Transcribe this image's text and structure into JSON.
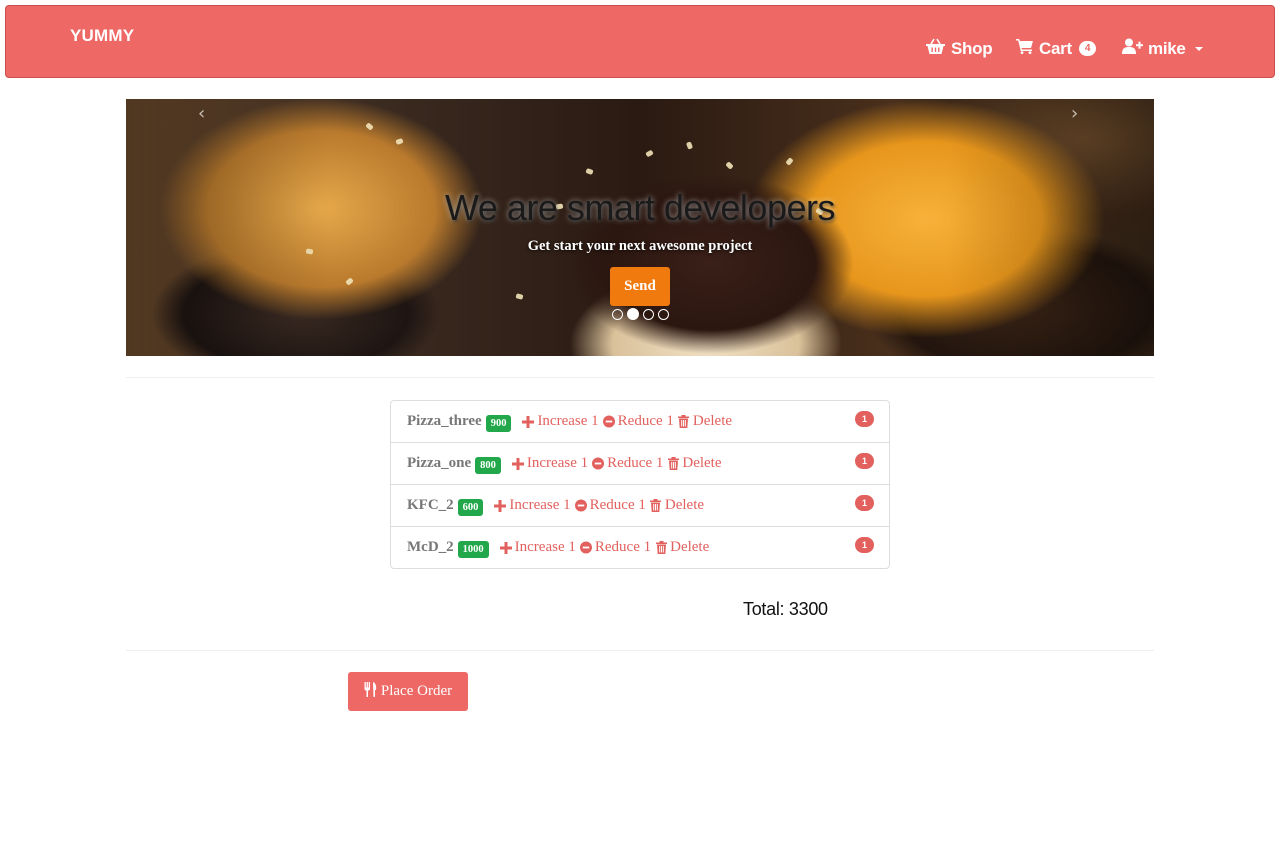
{
  "colors": {
    "navbar": "#ee6865",
    "accent": "#e2615e",
    "send_button": "#f07a0e",
    "price_badge": "#22a84a"
  },
  "navbar": {
    "brand": "YUMMY",
    "shop": {
      "label": "Shop",
      "icon": "shopping-basket-icon"
    },
    "cart": {
      "label": "Cart",
      "count": "4",
      "icon": "shopping-cart-icon"
    },
    "user": {
      "label": "mike",
      "icon": "user-plus-icon"
    }
  },
  "carousel": {
    "title": "We are smart developers",
    "subtitle": "Get start your next awesome project",
    "button": "Send",
    "prev_icon": "chevron-left-icon",
    "next_icon": "chevron-right-icon",
    "prev_glyph": "‹",
    "next_glyph": "›",
    "slide_count": 4,
    "active_index": 1
  },
  "cart": {
    "items": [
      {
        "name": "Pizza_three",
        "price": "900",
        "increase": "Increase 1",
        "reduce": "Reduce 1",
        "delete": "Delete",
        "qty": "1"
      },
      {
        "name": "Pizza_one",
        "price": "800",
        "increase": "Increase 1",
        "reduce": "Reduce 1",
        "delete": "Delete",
        "qty": "1"
      },
      {
        "name": "KFC_2",
        "price": "600",
        "increase": "Increase 1",
        "reduce": "Reduce 1",
        "delete": "Delete",
        "qty": "1"
      },
      {
        "name": "McD_2",
        "price": "1000",
        "increase": "Increase 1",
        "reduce": "Reduce 1",
        "delete": "Delete",
        "qty": "1"
      }
    ],
    "total": "Total: 3300"
  },
  "order": {
    "label": "Place Order",
    "icon": "cutlery-icon"
  }
}
